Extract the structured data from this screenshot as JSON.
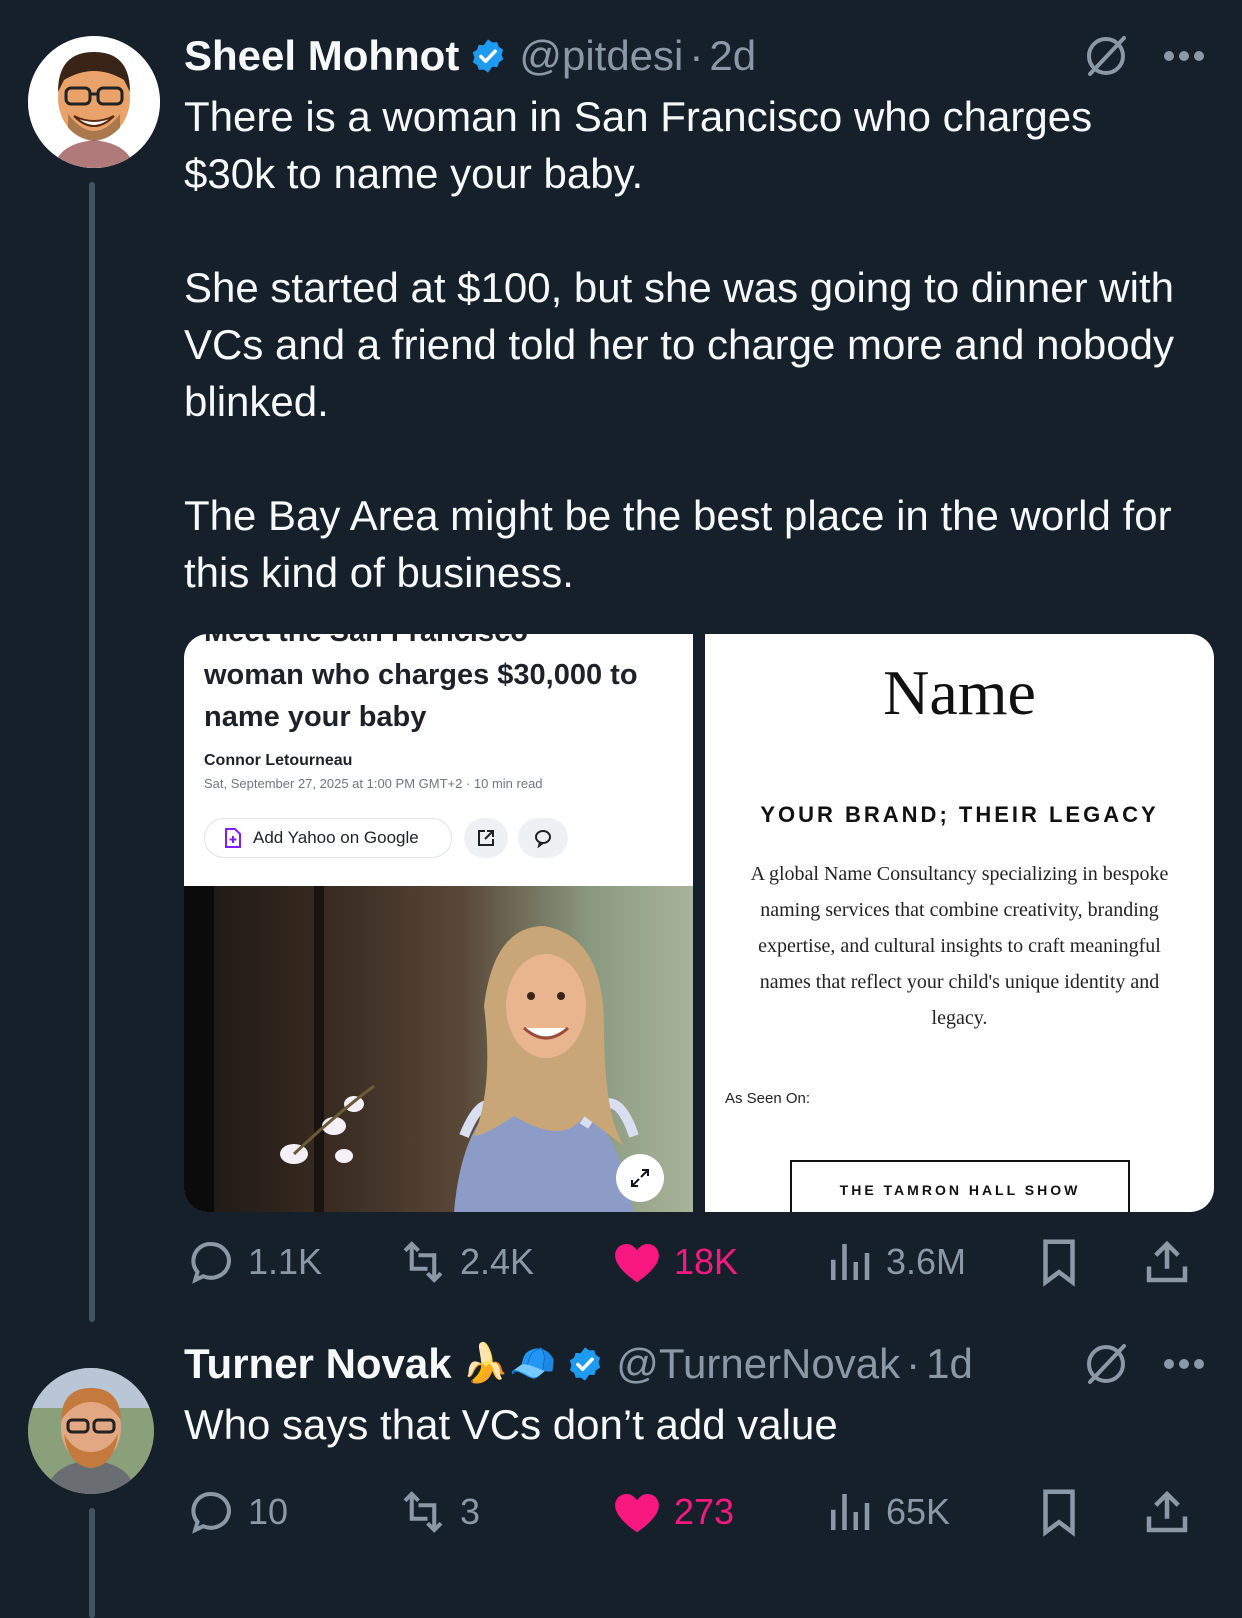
{
  "tweet1": {
    "author_name": "Sheel Mohnot",
    "handle": "@pitdesi",
    "separator": "·",
    "time": "2d",
    "body": "There is a woman in San Francisco who charges $30k to name your baby.\n\nShe started at $100, but she was going to dinner with VCs and a friend told her to charge more and nobody blinked.\n\nThe Bay Area might be the best place in the world for this kind of business.",
    "media": {
      "left": {
        "cut_headline": "Meet the San Francisco",
        "headline": "woman who charges $30,000 to name your baby",
        "author": "Connor Letourneau",
        "byline": "Sat, September 27, 2025 at 1:00 PM GMT+2 · 10 min read",
        "add_button": "Add Yahoo on Google"
      },
      "right": {
        "logo": "Name",
        "tagline": "YOUR BRAND; THEIR LEGACY",
        "description": "A global Name Consultancy specializing in bespoke naming services that combine creativity, branding expertise, and cultural insights to craft meaningful names that reflect your child's unique identity and legacy.",
        "as_seen_on": "As Seen On:",
        "show": "THE TAMRON HALL SHOW"
      }
    },
    "stats": {
      "replies": "1.1K",
      "reposts": "2.4K",
      "likes": "18K",
      "views": "3.6M"
    }
  },
  "tweet2": {
    "author_name": "Turner Novak",
    "emojis": "🍌🧢",
    "handle": "@TurnerNovak",
    "separator": "·",
    "time": "1d",
    "body": "Who says that VCs don’t add value",
    "stats": {
      "replies": "10",
      "reposts": "3",
      "likes": "273",
      "views": "65K"
    }
  },
  "colors": {
    "background": "#15202b",
    "text": "#f7f9f9",
    "muted": "#8b98a5",
    "verified": "#1d9bf0",
    "like": "#f91880"
  },
  "icons": [
    "verified-badge-icon",
    "grok-icon",
    "more-icon",
    "reply-icon",
    "repost-icon",
    "like-icon",
    "views-icon",
    "bookmark-icon",
    "share-icon",
    "expand-icon"
  ]
}
